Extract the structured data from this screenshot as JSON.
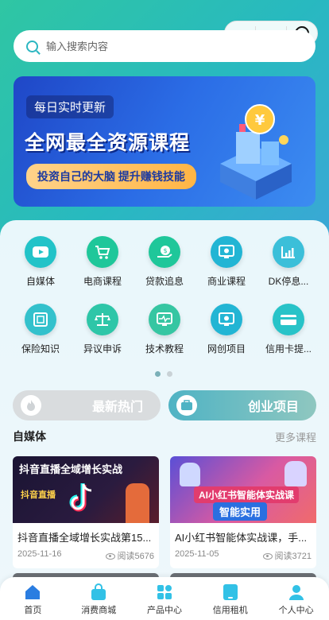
{
  "search": {
    "placeholder": "输入搜索内容"
  },
  "banner": {
    "tag": "每日实时更新",
    "headline": "全网最全资源课程",
    "pill": "投资自己的大脑 提升赚钱技能",
    "coin_symbol": "¥"
  },
  "categories": [
    {
      "label": "自媒体",
      "color": "#22c3c8",
      "icon": "video-icon"
    },
    {
      "label": "电商课程",
      "color": "#1fc79a",
      "icon": "cart-icon"
    },
    {
      "label": "贷款追息",
      "color": "#1fc79a",
      "icon": "coin-hand-icon"
    },
    {
      "label": "商业课程",
      "color": "#22b5d4",
      "icon": "monitor-coin-icon"
    },
    {
      "label": "DK停息...",
      "color": "#3bbfd9",
      "icon": "chart-icon"
    },
    {
      "label": "保险知识",
      "color": "#33c1cc",
      "icon": "safe-icon"
    },
    {
      "label": "异议申诉",
      "color": "#2ec6a8",
      "icon": "scale-icon"
    },
    {
      "label": "技术教程",
      "color": "#36c6a2",
      "icon": "pulse-monitor-icon"
    },
    {
      "label": "网创项目",
      "color": "#22b5d4",
      "icon": "monitor-coin-icon"
    },
    {
      "label": "信用卡提...",
      "color": "#28c3c8",
      "icon": "card-icon"
    }
  ],
  "hot_tabs": [
    {
      "label": "最新热门",
      "active": false
    },
    {
      "label": "创业项目",
      "active": true
    }
  ],
  "section": {
    "title": "自媒体",
    "more": "更多课程"
  },
  "courses": [
    {
      "thumb_title": "抖音直播全域增长实战",
      "thumb_sub": "抖音直播",
      "title": "抖音直播全域增长实战第15...",
      "date": "2025-11-16",
      "views": "阅读5676"
    },
    {
      "thumb_title": "AI小红书智能体实战课",
      "thumb_sub": "智能实用",
      "title": "AI小红书智能体实战课，手...",
      "date": "2025-11-05",
      "views": "阅读3721"
    }
  ],
  "tabbar": [
    {
      "label": "首页",
      "icon": "home-icon",
      "active": true
    },
    {
      "label": "消费商城",
      "icon": "bag-icon",
      "active": false
    },
    {
      "label": "产品中心",
      "icon": "grid-icon",
      "active": false
    },
    {
      "label": "信用租机",
      "icon": "phone-icon",
      "active": false
    },
    {
      "label": "个人中心",
      "icon": "user-icon",
      "active": false
    }
  ],
  "colors": {
    "accent": "#2bb6c1",
    "tab_active": "#2a7de1",
    "tab_icon": "#32c1e6"
  }
}
